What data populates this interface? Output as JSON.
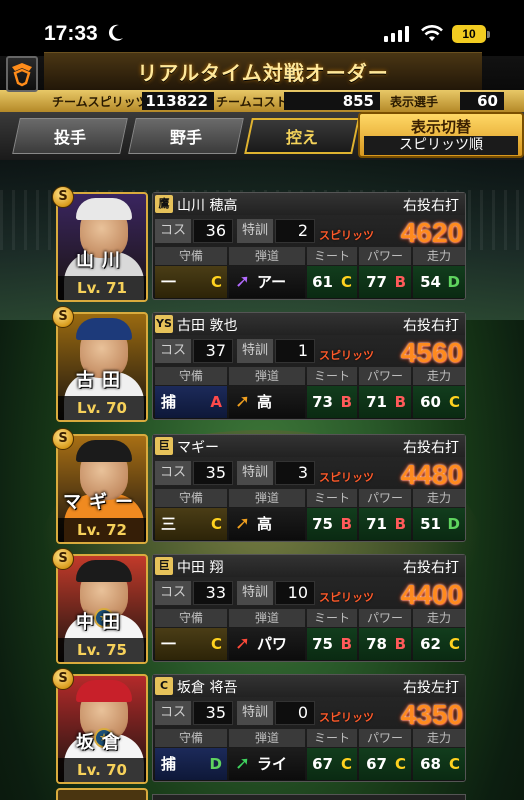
{
  "status": {
    "time": "17:33",
    "battery": "10"
  },
  "header": {
    "title": "リアルタイム対戦オーダー",
    "team_spirits_label": "チームスピリッツ",
    "team_spirits_value": "113822",
    "team_cost_label": "チームコスト",
    "team_cost_value": "855",
    "display_players_label": "表示選手",
    "display_players_value": "60"
  },
  "tabs": {
    "pitcher": "投手",
    "fielder": "野手",
    "bench": "控え",
    "active": "bench"
  },
  "sort": {
    "title": "表示切替",
    "mode": "スピリッツ順"
  },
  "labels": {
    "cost": "コス",
    "training": "特訓",
    "spirits": "スピリッツ",
    "defense": "守備",
    "trajectory": "弾道",
    "meet": "ミート",
    "power": "パワー",
    "speed": "走力"
  },
  "players": [
    {
      "team_icon": "鷹",
      "name": "山川 穂高",
      "portrait_name": "山川",
      "level": "Lv. 71",
      "hand": "右投右打",
      "cost": "36",
      "training": "2",
      "spirits": "4620",
      "position": "一",
      "position_grade": "C",
      "trajectory": "アー",
      "trajectory_arrow_color": "#b36bff",
      "meet": "61",
      "meet_grade": "C",
      "power": "77",
      "power_grade": "B",
      "speed": "54",
      "speed_grade": "D",
      "cap_color": "#e8e8e8",
      "jersey_color": "#d9d9d9",
      "bg_color": "#3a2560"
    },
    {
      "team_icon": "YS",
      "name": "古田 敦也",
      "portrait_name": "古田",
      "level": "Lv. 70",
      "hand": "右投右打",
      "cost": "37",
      "training": "1",
      "spirits": "4560",
      "position": "捕",
      "position_grade": "A",
      "trajectory": "高",
      "trajectory_arrow_color": "#f0a020",
      "meet": "73",
      "meet_grade": "B",
      "power": "71",
      "power_grade": "B",
      "speed": "60",
      "speed_grade": "C",
      "cap_color": "#1d3a7a",
      "jersey_color": "#f0f0f0",
      "bg_color": "#9a6a10"
    },
    {
      "team_icon": "巨",
      "name": "マギー",
      "portrait_name": "マギー",
      "level": "Lv. 72",
      "hand": "右投右打",
      "cost": "35",
      "training": "3",
      "spirits": "4480",
      "position": "三",
      "position_grade": "C",
      "trajectory": "高",
      "trajectory_arrow_color": "#f0a020",
      "meet": "75",
      "meet_grade": "B",
      "power": "71",
      "power_grade": "B",
      "speed": "51",
      "speed_grade": "D",
      "cap_color": "#1b1b1b",
      "jersey_color": "#f08a20",
      "bg_color": "#a86f14"
    },
    {
      "team_icon": "巨",
      "name": "中田 翔",
      "portrait_name": "中田",
      "level": "Lv. 75",
      "hand": "右投右打",
      "cost": "33",
      "training": "10",
      "spirits": "4400",
      "position": "一",
      "position_grade": "C",
      "trajectory": "パワ",
      "trajectory_arrow_color": "#ff4a3a",
      "meet": "75",
      "meet_grade": "B",
      "power": "78",
      "power_grade": "B",
      "speed": "62",
      "speed_grade": "C",
      "cap_color": "#1b1b1b",
      "jersey_color": "#f5f5f5",
      "bg_color": "#c23a2a"
    },
    {
      "team_icon": "C",
      "name": "坂倉 将吾",
      "portrait_name": "坂倉",
      "level": "Lv. 70",
      "hand": "右投左打",
      "cost": "35",
      "training": "0",
      "spirits": "4350",
      "position": "捕",
      "position_grade": "D",
      "trajectory": "ライ",
      "trajectory_arrow_color": "#3fd35f",
      "meet": "67",
      "meet_grade": "C",
      "power": "67",
      "power_grade": "C",
      "speed": "68",
      "speed_grade": "C",
      "cap_color": "#c8202a",
      "jersey_color": "#f5f5f5",
      "bg_color": "#b42a2a"
    }
  ]
}
